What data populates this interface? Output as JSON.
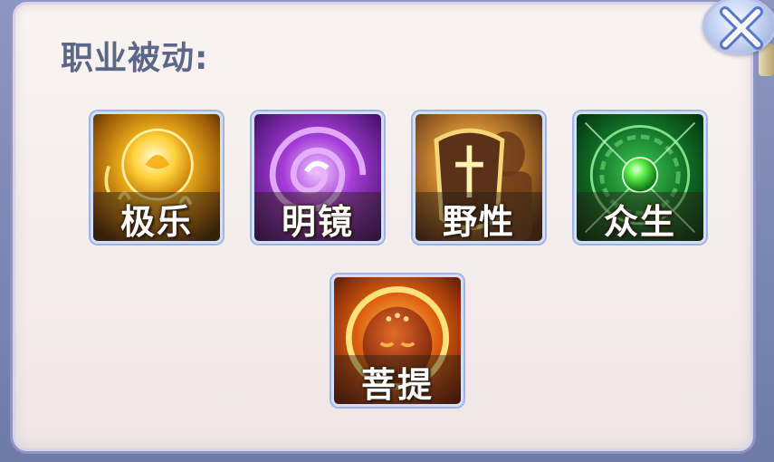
{
  "panel": {
    "title": "职业被动:"
  },
  "skills": [
    {
      "name": "极乐",
      "icon": "golden-orb-icon"
    },
    {
      "name": "明镜",
      "icon": "purple-swirl-icon"
    },
    {
      "name": "野性",
      "icon": "shield-warrior-icon"
    },
    {
      "name": "众生",
      "icon": "green-seal-orb-icon"
    },
    {
      "name": "菩提",
      "icon": "monk-halo-icon"
    }
  ],
  "close_button": {
    "icon": "close-icon"
  }
}
